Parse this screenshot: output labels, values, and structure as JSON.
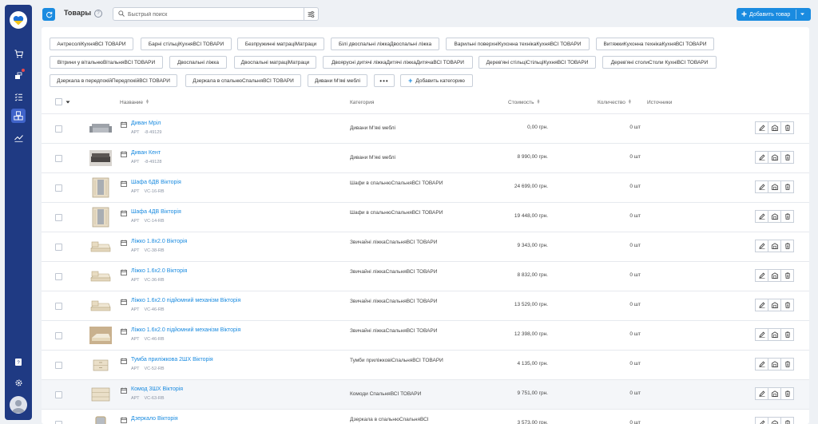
{
  "header": {
    "title": "Товары",
    "search_placeholder": "Быстрый поиск",
    "add_label": "Добавить товар"
  },
  "categories": [
    {
      "label": "АнтресоліКухняВСІ ТОВАРИ"
    },
    {
      "label": "Барні стільціКухняВСІ ТОВАРИ"
    },
    {
      "label": "Безпружинні матраціМатраци"
    },
    {
      "label": "Білі двоспальні ліжкаДвоспальні ліжка"
    },
    {
      "label": "Варильні поверхніКухонна технікаКухняВСІ ТОВАРИ"
    },
    {
      "label": "ВитяжкиКухонна технікаКухняВСІ ТОВАРИ"
    },
    {
      "label": "Вітрини у вітальнюВітальняВСІ ТОВАРИ"
    },
    {
      "label": "Двоспальні ліжка"
    },
    {
      "label": "Двоспальні матраціМатраци"
    },
    {
      "label": "Двоярусні дитячі ліжкаДитячі ліжкаДитячаВСІ ТОВАРИ"
    },
    {
      "label": "Дерев'яні стільціСтільціКухняВСІ ТОВАРИ"
    },
    {
      "label": "Дерев'яні столиСтоли КухніВСІ ТОВАРИ"
    },
    {
      "label": "Дзеркала в передпокійПередпокійВСІ ТОВАРИ"
    },
    {
      "label": "Дзеркала в спальнюСпальняВСІ ТОВАРИ"
    },
    {
      "label": "Дивани М'які меблі"
    }
  ],
  "more_label": "•••",
  "add_category_label": "Добавить категорию",
  "columns": {
    "name": "Название",
    "category": "Категория",
    "price": "Стоимость",
    "qty": "Количество",
    "sources": "Источники"
  },
  "rows": [
    {
      "name": "Диван Мріл",
      "art_label": "АРТ",
      "art": "-8-49129",
      "category": "Дивани М'які меблі",
      "price": "0,00 грн.",
      "qty": "0 шт",
      "thumb": "sofa-gray"
    },
    {
      "name": "Диван Кент",
      "art_label": "АРТ",
      "art": "-8-49128",
      "category": "Дивани М'які меблі",
      "price": "8 990,00 грн.",
      "qty": "0 шт",
      "thumb": "sofa-dark"
    },
    {
      "name": "Шафа 6ДВ Вікторія",
      "art_label": "АРТ",
      "art": "VC-16-RB",
      "category": "Шафи в спальнюСпальняВСІ ТОВАРИ",
      "price": "24 699,00 грн.",
      "qty": "0 шт",
      "thumb": "wardrobe"
    },
    {
      "name": "Шафа 4ДВ Вікторія",
      "art_label": "АРТ",
      "art": "VC-14-RB",
      "category": "Шафи в спальнюСпальняВСІ ТОВАРИ",
      "price": "19 448,00 грн.",
      "qty": "0 шт",
      "thumb": "wardrobe"
    },
    {
      "name": "Ліжко 1.8х2.0 Вікторія",
      "art_label": "АРТ",
      "art": "VC-38-RB",
      "category": "Звичайні ліжкаСпальняВСІ ТОВАРИ",
      "price": "9 343,00 грн.",
      "qty": "0 шт",
      "thumb": "bed"
    },
    {
      "name": "Ліжко 1.6х2.0 Вікторія",
      "art_label": "АРТ",
      "art": "VC-36-RB",
      "category": "Звичайні ліжкаСпальняВСІ ТОВАРИ",
      "price": "8 832,00 грн.",
      "qty": "0 шт",
      "thumb": "bed"
    },
    {
      "name": "Ліжко 1.6х2.0 підйомний механізм Вікторія",
      "art_label": "АРТ",
      "art": "VC-46-RB",
      "category": "Звичайні ліжкаСпальняВСІ ТОВАРИ",
      "price": "13 529,00 грн.",
      "qty": "0 шт",
      "thumb": "bed"
    },
    {
      "name": "Ліжко 1.6х2.0 підйомний механізм Вікторія",
      "art_label": "АРТ",
      "art": "VC-46-RB",
      "category": "Звичайні ліжкаСпальняВСІ ТОВАРИ",
      "price": "12 398,00 грн.",
      "qty": "0 шт",
      "thumb": "bed-room"
    },
    {
      "name": "Тумба приліжкова 2ШХ Вікторія",
      "art_label": "АРТ",
      "art": "VC-52-RB",
      "category": "Тумби приліжковіСпальняВСІ ТОВАРИ",
      "price": "4 135,00 грн.",
      "qty": "0 шт",
      "thumb": "nightstand"
    },
    {
      "name": "Комод 3ШХ Вікторія",
      "art_label": "АРТ",
      "art": "VC-63-RB",
      "category": "Комоди СпальняВСІ ТОВАРИ",
      "price": "9 751,00 грн.",
      "qty": "0 шт",
      "thumb": "dresser"
    },
    {
      "name": "Дзеркало Вікторія",
      "art_label": "",
      "art": "",
      "category": "Дзеркала в спальнюСпальняВСІ",
      "price": "3 573,00 грн.",
      "qty": "0 шт",
      "thumb": "mirror"
    }
  ],
  "colors": {
    "sidebar": "#1f3a83",
    "accent": "#1a8be0",
    "background": "#eef1f5"
  }
}
